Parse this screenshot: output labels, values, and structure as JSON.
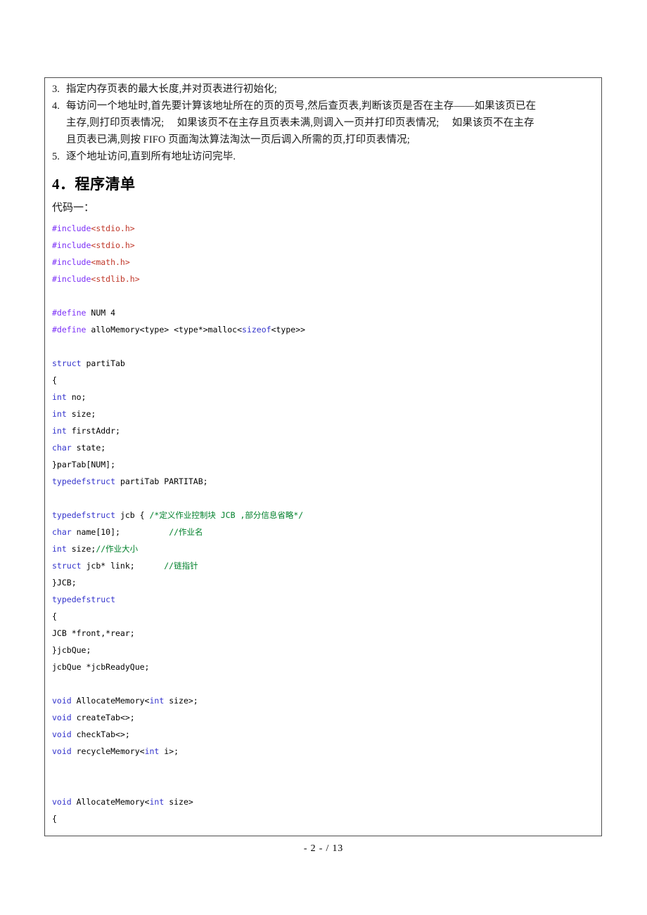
{
  "document": {
    "page_number_text": "- 2 -  / 13"
  },
  "colors": {
    "preprocessor": "#7b2ff7",
    "string": "#c0392b",
    "keyword": "#3333cc",
    "comment": "#00802b",
    "plain": "#000000",
    "border": "#4d4d4d"
  },
  "list": {
    "items": [
      {
        "num": "3.",
        "lines": [
          "指定内存页表的最大长度,并对页表进行初始化;"
        ]
      },
      {
        "num": "4.",
        "lines": [
          "每访问一个地址时,首先要计算该地址所在的页的页号,然后查页表,判断该页是否在主存——如果该页已在",
          "主存,则打印页表情况;　 如果该页不在主存且页表未满,则调入一页并打印页表情况;　 如果该页不在主存",
          "且页表已满,则按 FIFO 页面淘汰算法淘汰一页后调入所需的页,打印页表情况;"
        ]
      },
      {
        "num": "5.",
        "lines": [
          "逐个地址访问,直到所有地址访问完毕."
        ]
      }
    ]
  },
  "section": {
    "heading": "4．程序清单",
    "sub_label": "代码一："
  },
  "code": {
    "lines": [
      [
        {
          "t": "#include",
          "c": "pre"
        },
        {
          "t": "<stdio.h>",
          "c": "str"
        }
      ],
      [
        {
          "t": "#include",
          "c": "pre"
        },
        {
          "t": "<stdio.h>",
          "c": "str"
        }
      ],
      [
        {
          "t": "#include",
          "c": "pre"
        },
        {
          "t": "<math.h>",
          "c": "str"
        }
      ],
      [
        {
          "t": "#include",
          "c": "pre"
        },
        {
          "t": "<stdlib.h>",
          "c": "str"
        }
      ],
      [],
      [
        {
          "t": "#define",
          "c": "pre"
        },
        {
          "t": " NUM 4",
          "c": "plain"
        }
      ],
      [
        {
          "t": "#define",
          "c": "pre"
        },
        {
          "t": " alloMemory<type> <type*>malloc<",
          "c": "plain"
        },
        {
          "t": "sizeof",
          "c": "kw"
        },
        {
          "t": "<type>>",
          "c": "plain"
        }
      ],
      [],
      [
        {
          "t": "struct",
          "c": "kw"
        },
        {
          "t": " partiTab",
          "c": "plain"
        }
      ],
      [
        {
          "t": "{",
          "c": "plain"
        }
      ],
      [
        {
          "t": "int",
          "c": "kw"
        },
        {
          "t": " no;",
          "c": "plain"
        }
      ],
      [
        {
          "t": "int",
          "c": "kw"
        },
        {
          "t": " size;",
          "c": "plain"
        }
      ],
      [
        {
          "t": "int",
          "c": "kw"
        },
        {
          "t": " firstAddr;",
          "c": "plain"
        }
      ],
      [
        {
          "t": "char",
          "c": "kw"
        },
        {
          "t": " state;",
          "c": "plain"
        }
      ],
      [
        {
          "t": "}parTab[NUM];",
          "c": "plain"
        }
      ],
      [
        {
          "t": "typedefstruct",
          "c": "kw"
        },
        {
          "t": " partiTab PARTITAB;",
          "c": "plain"
        }
      ],
      [],
      [
        {
          "t": "typedefstruct",
          "c": "kw"
        },
        {
          "t": " jcb { ",
          "c": "plain"
        },
        {
          "t": "/*定义作业控制块 JCB ,部分信息省略*/",
          "c": "cmt"
        }
      ],
      [
        {
          "t": "char",
          "c": "kw"
        },
        {
          "t": " name[10];          ",
          "c": "plain"
        },
        {
          "t": "//作业名",
          "c": "cmt"
        }
      ],
      [
        {
          "t": "int",
          "c": "kw"
        },
        {
          "t": " size;",
          "c": "plain"
        },
        {
          "t": "//作业大小",
          "c": "cmt"
        }
      ],
      [
        {
          "t": "struct",
          "c": "kw"
        },
        {
          "t": " jcb* link;      ",
          "c": "plain"
        },
        {
          "t": "//链指针",
          "c": "cmt"
        }
      ],
      [
        {
          "t": "}JCB;",
          "c": "plain"
        }
      ],
      [
        {
          "t": "typedefstruct",
          "c": "kw"
        }
      ],
      [
        {
          "t": "{",
          "c": "plain"
        }
      ],
      [
        {
          "t": "JCB *front,*rear;",
          "c": "plain"
        }
      ],
      [
        {
          "t": "}jcbQue;",
          "c": "plain"
        }
      ],
      [
        {
          "t": "jcbQue *jcbReadyQue;",
          "c": "plain"
        }
      ],
      [],
      [
        {
          "t": "void",
          "c": "kw"
        },
        {
          "t": " AllocateMemory<",
          "c": "plain"
        },
        {
          "t": "int",
          "c": "kw"
        },
        {
          "t": " size>;",
          "c": "plain"
        }
      ],
      [
        {
          "t": "void",
          "c": "kw"
        },
        {
          "t": " createTab<>;",
          "c": "plain"
        }
      ],
      [
        {
          "t": "void",
          "c": "kw"
        },
        {
          "t": " checkTab<>;",
          "c": "plain"
        }
      ],
      [
        {
          "t": "void",
          "c": "kw"
        },
        {
          "t": " recycleMemory<",
          "c": "plain"
        },
        {
          "t": "int",
          "c": "kw"
        },
        {
          "t": " i>;",
          "c": "plain"
        }
      ],
      [],
      [],
      [
        {
          "t": "void",
          "c": "kw"
        },
        {
          "t": " AllocateMemory<",
          "c": "plain"
        },
        {
          "t": "int",
          "c": "kw"
        },
        {
          "t": " size>",
          "c": "plain"
        }
      ],
      [
        {
          "t": "{",
          "c": "plain"
        }
      ]
    ]
  }
}
